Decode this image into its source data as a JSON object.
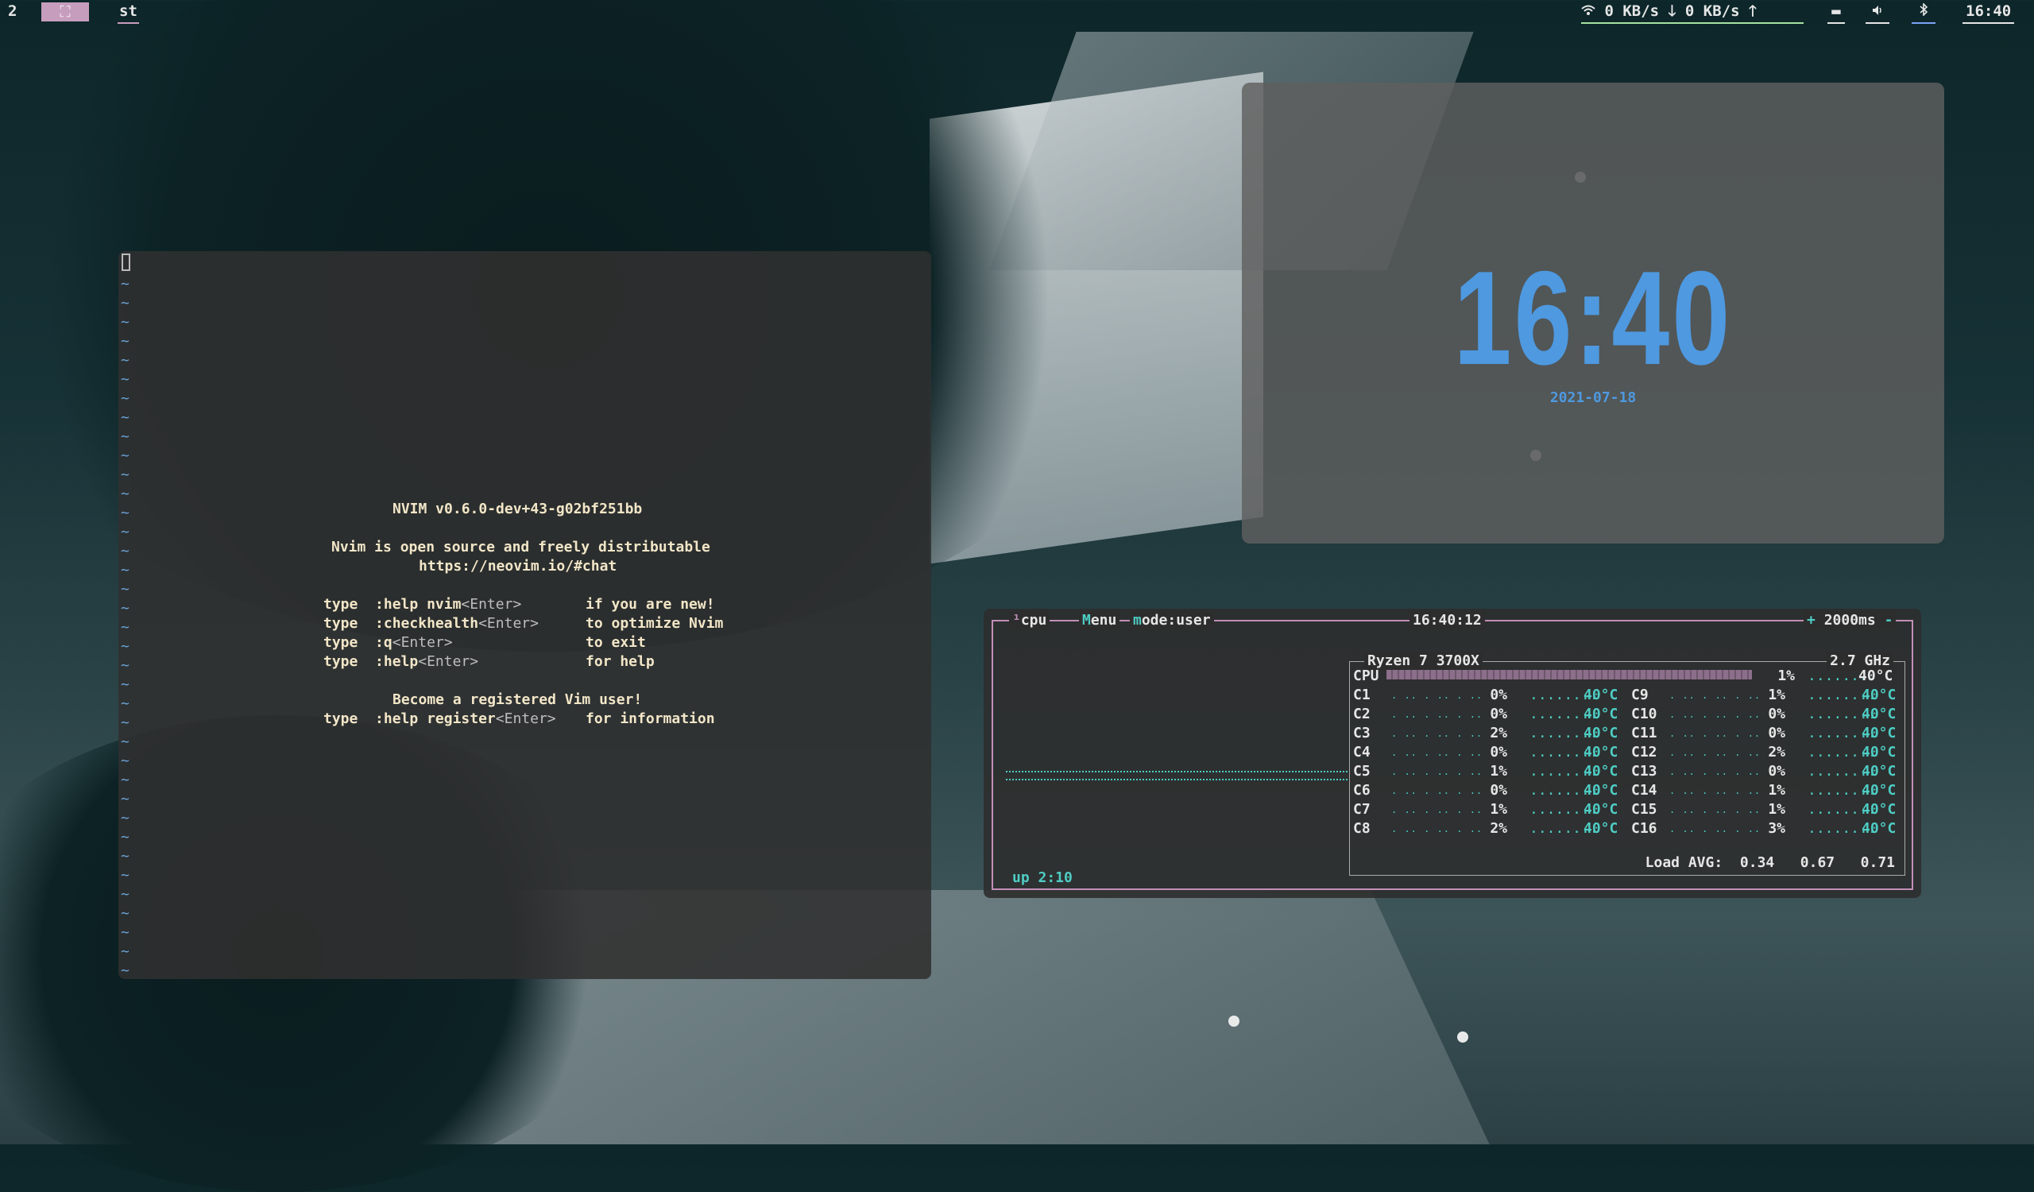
{
  "topbar": {
    "tag_number": "2",
    "layout_symbol": "⛶",
    "window_title": "st",
    "net_down": "0 KB/s",
    "net_up": "0 KB/s",
    "wifi_icon": "wifi-icon",
    "battery_icon": "battery-icon",
    "volume_icon": "volume-icon",
    "bluetooth_icon": "bluetooth-icon",
    "time": "16:40"
  },
  "nvim": {
    "version": "NVIM v0.6.0-dev+43-g02bf251bb",
    "line1": "Nvim is open source and freely distributable",
    "line2": "https://neovim.io/#chat",
    "help_rows": [
      {
        "type": "type",
        "cmd": ":help nvim",
        "key": "<Enter>",
        "desc": "if you are new!"
      },
      {
        "type": "type",
        "cmd": ":checkhealth",
        "key": "<Enter>",
        "desc": "to optimize Nvim"
      },
      {
        "type": "type",
        "cmd": ":q",
        "key": "<Enter>",
        "desc": "to exit"
      },
      {
        "type": "type",
        "cmd": ":help",
        "key": "<Enter>",
        "desc": "for help"
      }
    ],
    "register_line": "Become a registered Vim user!",
    "register_row": {
      "type": "type",
      "cmd": ":help register",
      "key": "<Enter>",
      "desc": "for information"
    },
    "tilde": "~"
  },
  "clock": {
    "time": "16:40",
    "date": "2021-07-18"
  },
  "btop": {
    "tab_cpu": "cpu",
    "menu": "Menu",
    "mode": "mode:user",
    "time": "16:40:12",
    "plus": "+",
    "interval": "2000ms",
    "minus": "-",
    "cpu_name": "Ryzen 7 3700X",
    "freq": "2.7 GHz",
    "cpu_label": "CPU",
    "cpu_total_pct": "1%",
    "cpu_total_temp": "40°C",
    "cores_left": [
      {
        "name": "C1",
        "pct": "0%",
        "temp": "40°C"
      },
      {
        "name": "C2",
        "pct": "0%",
        "temp": "40°C"
      },
      {
        "name": "C3",
        "pct": "2%",
        "temp": "40°C"
      },
      {
        "name": "C4",
        "pct": "0%",
        "temp": "40°C"
      },
      {
        "name": "C5",
        "pct": "1%",
        "temp": "40°C"
      },
      {
        "name": "C6",
        "pct": "0%",
        "temp": "40°C"
      },
      {
        "name": "C7",
        "pct": "1%",
        "temp": "40°C"
      },
      {
        "name": "C8",
        "pct": "2%",
        "temp": "40°C"
      }
    ],
    "cores_right": [
      {
        "name": "C9",
        "pct": "1%",
        "temp": "40°C"
      },
      {
        "name": "C10",
        "pct": "0%",
        "temp": "40°C"
      },
      {
        "name": "C11",
        "pct": "0%",
        "temp": "40°C"
      },
      {
        "name": "C12",
        "pct": "2%",
        "temp": "40°C"
      },
      {
        "name": "C13",
        "pct": "0%",
        "temp": "40°C"
      },
      {
        "name": "C14",
        "pct": "1%",
        "temp": "40°C"
      },
      {
        "name": "C15",
        "pct": "1%",
        "temp": "40°C"
      },
      {
        "name": "C16",
        "pct": "3%",
        "temp": "40°C"
      }
    ],
    "load_label": "Load AVG:",
    "load_1": "0.34",
    "load_5": "0.67",
    "load_15": "0.71",
    "uptime": "up 2:10"
  }
}
